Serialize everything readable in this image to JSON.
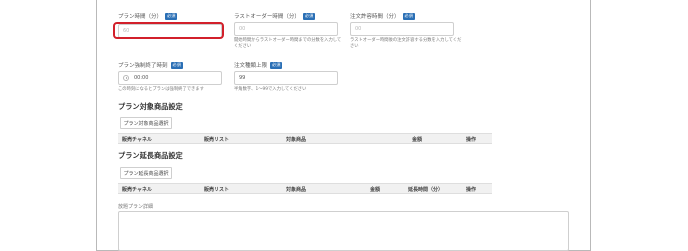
{
  "form": {
    "required_badge": "必須",
    "plan_time": {
      "label": "プラン時間（分）",
      "placeholder": "60"
    },
    "last_order": {
      "label": "ラストオーダー時間（分）",
      "placeholder": "00",
      "help": "開始時間からラストオーダー時間までの分数を入力してください"
    },
    "order_allow": {
      "label": "注文許容時間（分）",
      "placeholder": "00",
      "help": "ラストオーダー時間後の注文許容する分数を入力してください"
    },
    "forced_end": {
      "label": "プラン強制終了時刻",
      "value": "00:00",
      "help": "この時刻になるとプランは強制終了できます"
    },
    "order_limit": {
      "label": "注文種類上限",
      "value": "99",
      "help": "半角数字、1〜99で入力してください"
    }
  },
  "target_products": {
    "title": "プラン対象商品設定",
    "button": "プラン対象商品選択",
    "columns": [
      "販売チャネル",
      "販売リスト",
      "対象商品",
      "金額",
      "操作"
    ]
  },
  "extension_products": {
    "title": "プラン延長商品設定",
    "button": "プラン延長商品選択",
    "columns": [
      "販売チャネル",
      "販売リスト",
      "対象商品",
      "金額",
      "延長時間（分）",
      "操作"
    ]
  },
  "details": {
    "label": "放題プラン詳細"
  },
  "colors": {
    "accent": "#2a6fb5",
    "highlight": "#d2202b"
  }
}
